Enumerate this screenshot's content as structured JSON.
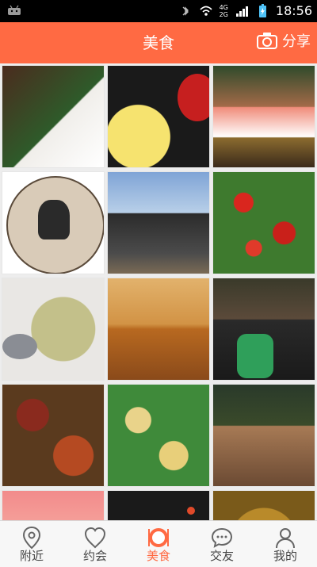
{
  "status_bar": {
    "time": "18:56",
    "network_labels": [
      "4G",
      "2G"
    ]
  },
  "header": {
    "title": "美食",
    "share_label": "分享",
    "share_icon": "camera-icon"
  },
  "grid": {
    "rows": 5,
    "cols": 3,
    "tiles": [
      {
        "label": "tile-1"
      },
      {
        "label": "tile-2"
      },
      {
        "label": "tile-3"
      },
      {
        "label": "tile-4"
      },
      {
        "label": "tile-5"
      },
      {
        "label": "tile-6"
      },
      {
        "label": "tile-7"
      },
      {
        "label": "tile-8"
      },
      {
        "label": "tile-9"
      },
      {
        "label": "tile-10"
      },
      {
        "label": "tile-11"
      },
      {
        "label": "tile-12"
      },
      {
        "label": "tile-13"
      },
      {
        "label": "tile-14"
      },
      {
        "label": "tile-15"
      }
    ]
  },
  "bottom_nav": {
    "items": [
      {
        "label": "附近",
        "icon": "location-pin-icon",
        "active": false
      },
      {
        "label": "约会",
        "icon": "heart-icon",
        "active": false
      },
      {
        "label": "美食",
        "icon": "food-icon",
        "active": true
      },
      {
        "label": "交友",
        "icon": "chat-bubble-icon",
        "active": false
      },
      {
        "label": "我的",
        "icon": "person-icon",
        "active": false
      }
    ]
  },
  "colors": {
    "accent": "#ff6a43",
    "nav_bg": "#f7f7f7",
    "status_bg": "#000000"
  }
}
